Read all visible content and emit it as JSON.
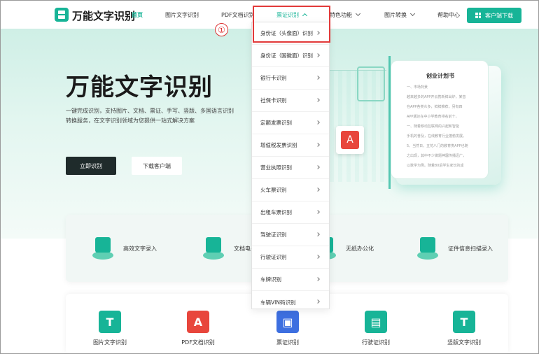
{
  "header": {
    "logo_text": "万能文字识别",
    "nav": [
      {
        "label": "首页",
        "active": true
      },
      {
        "label": "图片文字识别"
      },
      {
        "label": "PDF文档识别"
      },
      {
        "label": "票证识别"
      },
      {
        "label": "特色功能"
      },
      {
        "label": "图片转换"
      },
      {
        "label": "帮助中心"
      }
    ],
    "download_label": "客户端下载"
  },
  "hero": {
    "title": "万能文字识别",
    "desc_line1": "一键完成识别，支持图片、文档、票证、手写、竖版、多国语言识别",
    "desc_line2": "转换服务，在文字识别领域为您提供一站式解决方案",
    "primary_btn": "立即识别",
    "secondary_btn": "下载客户端",
    "doc_title": "创业计划书",
    "doc_lines": [
      "一、市场背景",
      "越来越多的APP开云携新鲜出炉，某音",
      "在APP各类众多，鲜鲜推荐，另有四",
      "APP版还在中小学教育排名前十，",
      "一、随着移动互联网的兴起和智能",
      "手机的普及，在线教育行业蓬勃发展。",
      "5、当然日，五花八门的教育类APP也随",
      "之出现，其中不少做题神器传播迅广，",
      "以数学为例。随着80后学生家长的成"
    ]
  },
  "features": [
    {
      "label": "高效文字录入"
    },
    {
      "label": "文档电子化"
    },
    {
      "label": "无纸办公化"
    },
    {
      "label": "证件信息扫描录入"
    }
  ],
  "tools": [
    {
      "label": "图片文字识别",
      "color": "#17b497",
      "glyph": "T"
    },
    {
      "label": "PDF文档识别",
      "color": "#e8463c",
      "glyph": "A"
    },
    {
      "label": "票证识别",
      "color": "#3d6fe0",
      "glyph": "▣"
    },
    {
      "label": "行驶证识别",
      "color": "#17b497",
      "glyph": "▤"
    },
    {
      "label": "竖版文字识别",
      "color": "#17b497",
      "glyph": "T"
    }
  ],
  "dropdown": {
    "items": [
      "身份证（头像面）识别",
      "身份证（国徽面）识别",
      "银行卡识别",
      "社保卡识别",
      "定额发票识别",
      "增值税发票识别",
      "营业执照识别",
      "火车票识别",
      "出租车票识别",
      "驾驶证识别",
      "行驶证识别",
      "车牌识别",
      "车辆VIN码识别"
    ]
  },
  "annotation": {
    "badge": "①"
  },
  "colors": {
    "brand": "#17b497",
    "highlight": "#e23a3a"
  }
}
